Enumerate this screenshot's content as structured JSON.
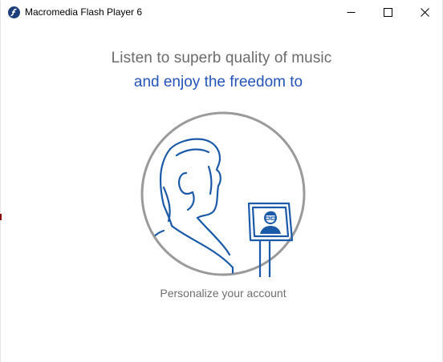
{
  "window": {
    "title": "Macromedia Flash Player 6",
    "icon": "flash-player-icon"
  },
  "controls": {
    "minimize_icon": "minimize-icon",
    "maximize_icon": "maximize-icon",
    "close_icon": "close-icon"
  },
  "main": {
    "headline_line1": "Listen to superb quality of music",
    "headline_line2": "and enjoy the freedom to",
    "illustration": "person-video-call-illustration",
    "caption": "Personalize your account"
  },
  "colors": {
    "accent_blue": "#2353b8",
    "illustration_blue": "#1a5aa8",
    "circle_gray": "#9a9a9a",
    "text_gray": "#6b6b6b"
  }
}
